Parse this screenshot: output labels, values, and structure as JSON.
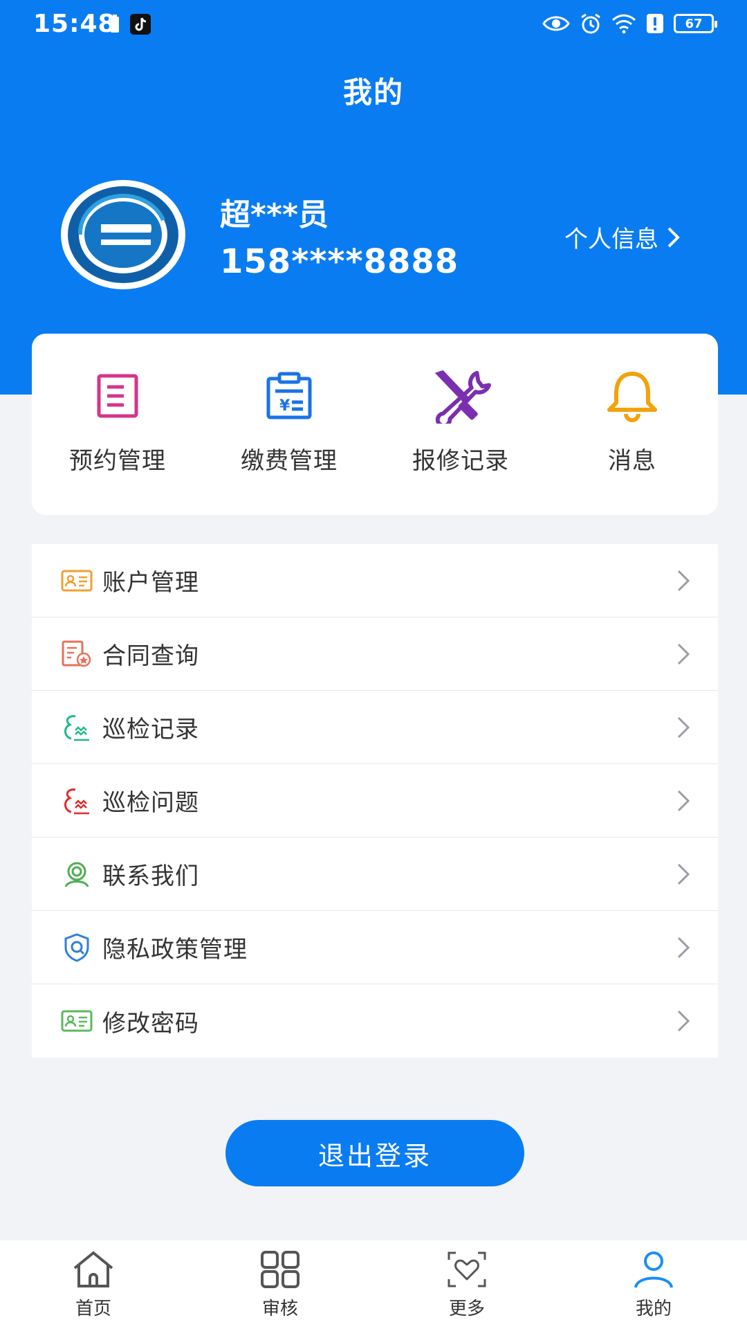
{
  "status_bar": {
    "time": "15:48",
    "battery": "67"
  },
  "header": {
    "title": "我的"
  },
  "profile": {
    "name": "超***员",
    "phone": "158****8888",
    "info_link": "个人信息"
  },
  "quick_actions": [
    {
      "label": "预约管理",
      "icon": "document-icon",
      "color": "#d6338a"
    },
    {
      "label": "缴费管理",
      "icon": "invoice-icon",
      "color": "#1a73e8"
    },
    {
      "label": "报修记录",
      "icon": "tools-icon",
      "color": "#7b2fb0"
    },
    {
      "label": "消息",
      "icon": "bell-icon",
      "color": "#f2a20c"
    }
  ],
  "menu": [
    {
      "label": "账户管理",
      "icon": "id-card-icon",
      "color": "#f0a030"
    },
    {
      "label": "合同查询",
      "icon": "contract-icon",
      "color": "#e8705a"
    },
    {
      "label": "巡检记录",
      "icon": "inspection-icon",
      "color": "#1fb88a"
    },
    {
      "label": "巡检问题",
      "icon": "inspection-issue-icon",
      "color": "#e02a2a"
    },
    {
      "label": "联系我们",
      "icon": "contact-icon",
      "color": "#4caf50"
    },
    {
      "label": "隐私政策管理",
      "icon": "shield-icon",
      "color": "#2f7fd8"
    },
    {
      "label": "修改密码",
      "icon": "id-card-icon",
      "color": "#5cb85c"
    }
  ],
  "logout_label": "退出登录",
  "bottom_nav": [
    {
      "label": "首页",
      "icon": "home-icon"
    },
    {
      "label": "审核",
      "icon": "grid-icon"
    },
    {
      "label": "更多",
      "icon": "heart-scan-icon"
    },
    {
      "label": "我的",
      "icon": "user-icon",
      "active": true
    }
  ],
  "colors": {
    "primary": "#0a7cf2",
    "background": "#f1f3f6"
  }
}
